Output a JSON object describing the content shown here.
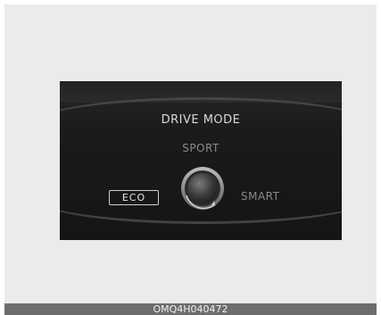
{
  "panel": {
    "title": "DRIVE MODE",
    "top_mode": "SPORT",
    "left_mode": "ECO",
    "right_mode": "SMART",
    "selected_mode": "ECO",
    "knob_icon": "rotary-knob-icon"
  },
  "caption": {
    "code": "OMQ4H040472"
  },
  "colors": {
    "panel_bg": "#1a1a1a",
    "frame_bg": "#ebebeb",
    "caption_bg": "#6d6d6d",
    "active_text": "#e6e6e6",
    "inactive_text": "#8a8a8a"
  }
}
